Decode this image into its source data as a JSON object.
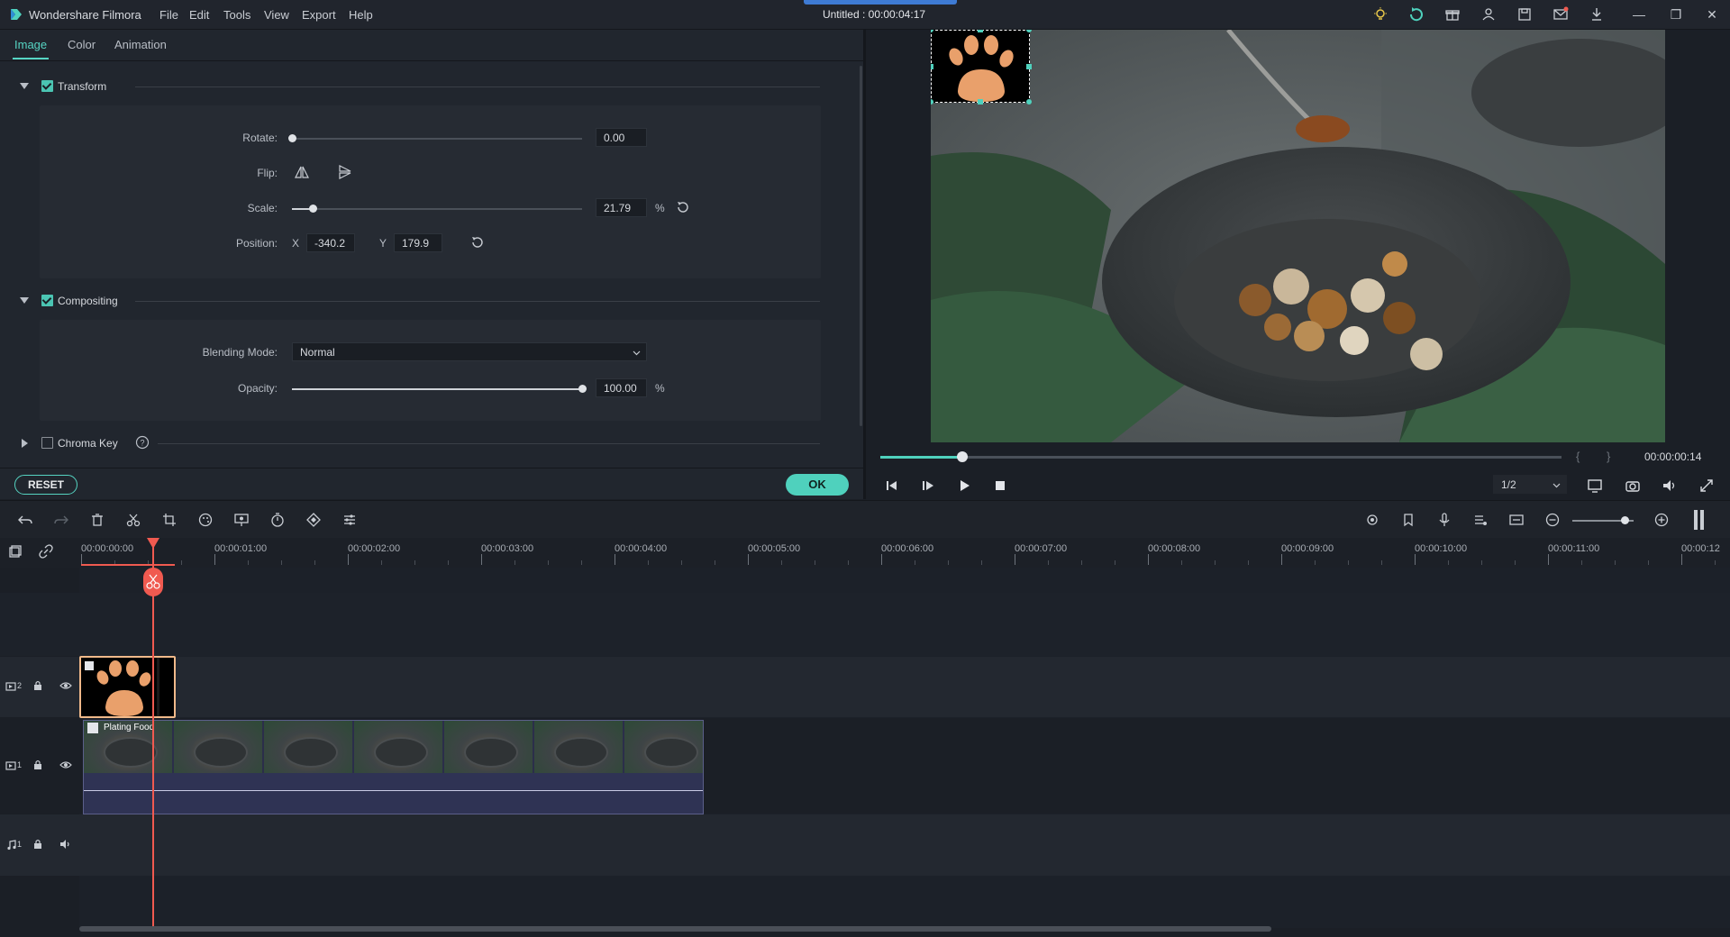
{
  "app": {
    "name": "Wondershare Filmora",
    "doc_title": "Untitled : 00:00:04:17",
    "menu": [
      "File",
      "Edit",
      "Tools",
      "View",
      "Export",
      "Help"
    ]
  },
  "panel": {
    "tabs": [
      "Image",
      "Color",
      "Animation"
    ],
    "active_tab": "Image",
    "transform": {
      "label": "Transform",
      "rotate_label": "Rotate:",
      "rotate_value": "0.00",
      "rotate_level": 0.0,
      "flip_label": "Flip:",
      "scale_label": "Scale:",
      "scale_value": "21.79",
      "scale_unit": "%",
      "scale_level": 0.07,
      "position_label": "Position:",
      "pos_x_label": "X",
      "pos_x": "-340.2",
      "pos_y_label": "Y",
      "pos_y": "179.9"
    },
    "compositing": {
      "label": "Compositing",
      "blend_label": "Blending Mode:",
      "blend_value": "Normal",
      "opacity_label": "Opacity:",
      "opacity_value": "100.00",
      "opacity_unit": "%",
      "opacity_level": 1.0
    },
    "chroma": {
      "label": "Chroma Key"
    },
    "reset_label": "RESET",
    "ok_label": "OK"
  },
  "preview": {
    "time": "00:00:00:14",
    "progress": 0.12,
    "quality": "1/2",
    "bracket_in": "{",
    "bracket_out": "}"
  },
  "timeline": {
    "ticks": [
      "00:00:00:00",
      "00:00:01:00",
      "00:00:02:00",
      "00:00:03:00",
      "00:00:04:00",
      "00:00:05:00",
      "00:00:06:00",
      "00:00:07:00",
      "00:00:08:00",
      "00:00:09:00",
      "00:00:10:00",
      "00:00:11:00",
      "00:00:12"
    ],
    "video_clip_label": "Plating Food",
    "track_labels": [
      "2",
      "1",
      "1"
    ],
    "zoom_level": 0.85
  },
  "colors": {
    "accent": "#4fd1bd",
    "playhead": "#f05a50",
    "paw": "#e9a06b",
    "clip_border": "#f0b98a"
  }
}
